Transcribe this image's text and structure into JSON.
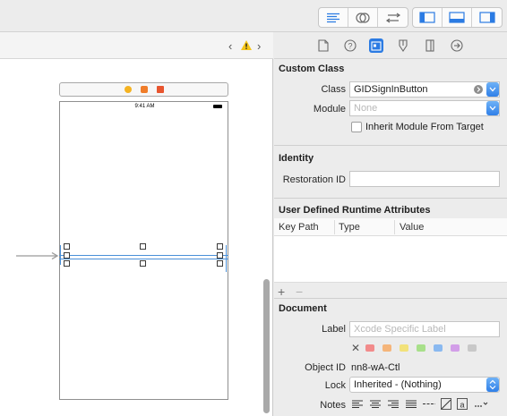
{
  "toolbar": {
    "editor_buttons": [
      "standard-editor-icon",
      "assistant-editor-icon",
      "version-editor-icon"
    ],
    "panel_buttons": [
      "navigator-panel-icon",
      "debug-area-icon",
      "utilities-panel-icon"
    ]
  },
  "canvas": {
    "status_time": "9:41 AM"
  },
  "inspector": {
    "custom_class": {
      "header": "Custom Class",
      "class_label": "Class",
      "class_value": "GIDSignInButton",
      "module_label": "Module",
      "module_placeholder": "None",
      "inherit_label": "Inherit Module From Target"
    },
    "identity": {
      "header": "Identity",
      "restoration_label": "Restoration ID",
      "restoration_value": ""
    },
    "runtime_attributes": {
      "header": "User Defined Runtime Attributes",
      "columns": [
        "Key Path",
        "Type",
        "Value"
      ],
      "add_label": "+",
      "remove_label": "−"
    },
    "document": {
      "header": "Document",
      "label_label": "Label",
      "label_placeholder": "Xcode Specific Label",
      "label_colors": [
        "#f28b8b",
        "#f5b57a",
        "#f2e27a",
        "#a8e08a",
        "#8ab9f0",
        "#d29ee8",
        "#c8c8c8"
      ],
      "object_id_label": "Object ID",
      "object_id_value": "nn8-wA-Ctl",
      "lock_label": "Lock",
      "lock_value": "Inherited - (Nothing)",
      "notes_label": "Notes"
    }
  }
}
